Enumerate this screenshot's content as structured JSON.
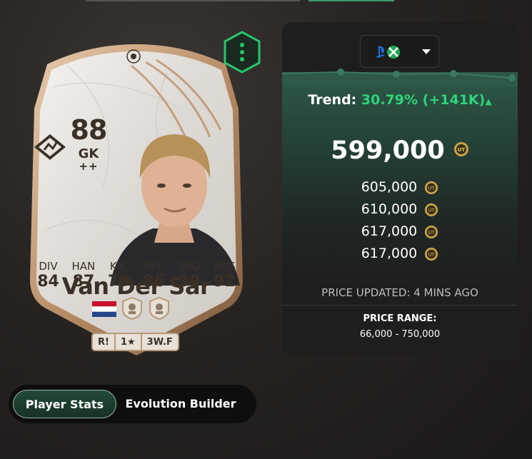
{
  "card": {
    "rating": "88",
    "position": "GK",
    "plus": "++",
    "name": "Van Der Sar",
    "stats": [
      {
        "label": "DIV",
        "value": "84"
      },
      {
        "label": "HAN",
        "value": "87"
      },
      {
        "label": "KIC",
        "value": "79"
      },
      {
        "label": "REF",
        "value": "86"
      },
      {
        "label": "SPD",
        "value": "39"
      },
      {
        "label": "POS",
        "value": "92"
      }
    ],
    "traits": [
      "R!",
      "1★",
      "3W.F"
    ],
    "icons": {
      "role": "goalkeeper-role-icon",
      "nation": "netherlands-flag-icon",
      "league": "icons-league-icon",
      "club": "icons-club-icon",
      "more": "more-vertical-icon"
    }
  },
  "price_panel": {
    "platform_icon": "playstation-xbox-icon",
    "trend_label": "Trend:",
    "trend_value": "30.79% (+141K)",
    "trend_arrow": "▲",
    "current_price": "599,000",
    "listings": [
      "605,000",
      "610,000",
      "617,000",
      "617,000"
    ],
    "updated": "PRICE UPDATED: 4 MINS AGO",
    "range_label": "PRICE RANGE:",
    "range_value": "66,000 - 750,000",
    "colors": {
      "trend": "#2ed37a",
      "accent": "#1faa55"
    }
  },
  "tabs": [
    {
      "label": "Player Stats",
      "active": true
    },
    {
      "label": "Evolution Builder",
      "active": false
    }
  ]
}
